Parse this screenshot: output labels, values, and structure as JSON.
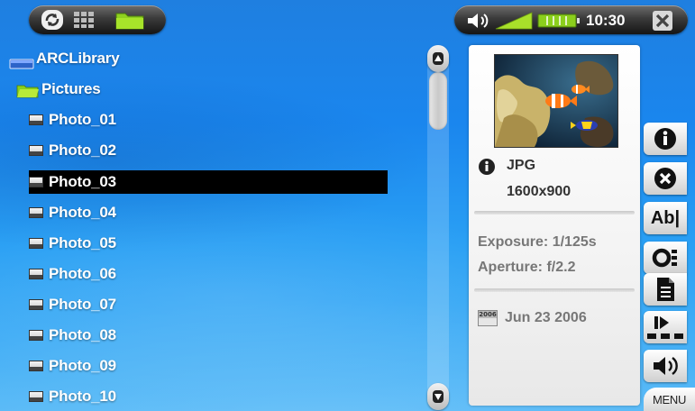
{
  "topbar": {
    "left_icons": [
      "refresh-icon",
      "grid-icon",
      "folder-icon"
    ],
    "volume_icon": "speaker-icon",
    "signal_icon": "signal-icon",
    "battery_icon": "battery-icon",
    "time": "10:30",
    "close_icon": "close-icon"
  },
  "tree": {
    "root_label": "ARCLibrary",
    "folder_label": "Pictures",
    "files": [
      {
        "label": "Photo_01",
        "selected": false
      },
      {
        "label": "Photo_02",
        "selected": false
      },
      {
        "label": "Photo_03",
        "selected": true
      },
      {
        "label": "Photo_04",
        "selected": false
      },
      {
        "label": "Photo_05",
        "selected": false
      },
      {
        "label": "Photo_06",
        "selected": false
      },
      {
        "label": "Photo_07",
        "selected": false
      },
      {
        "label": "Photo_08",
        "selected": false
      },
      {
        "label": "Photo_09",
        "selected": false
      },
      {
        "label": "Photo_10",
        "selected": false
      }
    ]
  },
  "info": {
    "format": "JPG",
    "resolution": "1600x900",
    "exposure_label": "Exposure:",
    "exposure_value": "1/125s",
    "aperture_label": "Aperture:",
    "aperture_value": "f/2.2",
    "calendar_year": "2006",
    "date": "Jun 23 2006"
  },
  "side_buttons": {
    "info_icon": "info-icon",
    "delete_icon": "delete-icon",
    "rename_label": "Ab|",
    "toggle_icon": "toggle-icon",
    "document_icon": "document-icon",
    "slideshow_icon": "slideshow-icon",
    "sound_icon": "sound-icon",
    "menu_label": "MENU"
  },
  "colors": {
    "background_top": "#1f7fe0",
    "background_bottom": "#56b9f7",
    "selection": "#000000",
    "panel": "#f3f3f3"
  }
}
